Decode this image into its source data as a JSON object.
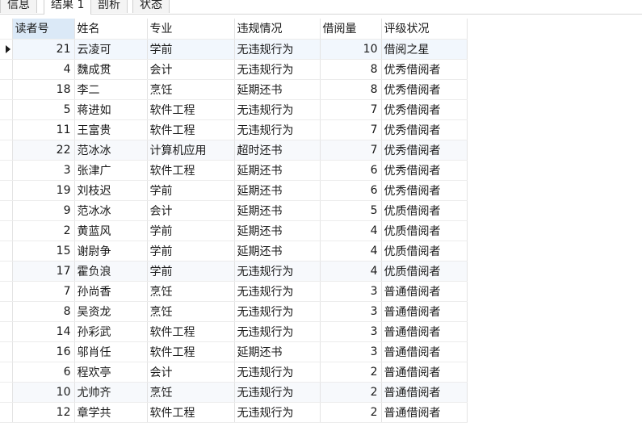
{
  "tabs": [
    {
      "label": "信息",
      "active": false
    },
    {
      "label": "结果 1",
      "active": true
    },
    {
      "label": "剖析",
      "active": false
    },
    {
      "label": "状态",
      "active": false
    }
  ],
  "table": {
    "columns": [
      "读者号",
      "姓名",
      "专业",
      "违规情况",
      "借阅量",
      "评级状况"
    ],
    "rows": [
      [
        "21",
        "云凌可",
        "学前",
        "无违规行为",
        "10",
        "借阅之星"
      ],
      [
        "4",
        "魏成贯",
        "会计",
        "无违规行为",
        "8",
        "优秀借阅者"
      ],
      [
        "18",
        "李二",
        "烹饪",
        "延期还书",
        "8",
        "优秀借阅者"
      ],
      [
        "5",
        "蒋进如",
        "软件工程",
        "无违规行为",
        "7",
        "优秀借阅者"
      ],
      [
        "11",
        "王富贵",
        "软件工程",
        "无违规行为",
        "7",
        "优秀借阅者"
      ],
      [
        "22",
        "范冰冰",
        "计算机应用",
        "超时还书",
        "7",
        "优秀借阅者"
      ],
      [
        "3",
        "张津广",
        "软件工程",
        "延期还书",
        "6",
        "优秀借阅者"
      ],
      [
        "19",
        "刘枝迟",
        "学前",
        "延期还书",
        "6",
        "优秀借阅者"
      ],
      [
        "9",
        "范冰冰",
        "会计",
        "延期还书",
        "5",
        "优质借阅者"
      ],
      [
        "2",
        "黄蓝风",
        "学前",
        "延期还书",
        "4",
        "优质借阅者"
      ],
      [
        "15",
        "谢尉争",
        "学前",
        "延期还书",
        "4",
        "优质借阅者"
      ],
      [
        "17",
        "霍负浪",
        "学前",
        "无违规行为",
        "4",
        "优质借阅者"
      ],
      [
        "7",
        "孙尚香",
        "烹饪",
        "无违规行为",
        "3",
        "普通借阅者"
      ],
      [
        "8",
        "吴资龙",
        "烹饪",
        "无违规行为",
        "3",
        "普通借阅者"
      ],
      [
        "14",
        "孙彩武",
        "软件工程",
        "无违规行为",
        "3",
        "普通借阅者"
      ],
      [
        "16",
        "邬肖任",
        "软件工程",
        "延期还书",
        "3",
        "普通借阅者"
      ],
      [
        "6",
        "程欢亭",
        "会计",
        "无违规行为",
        "2",
        "普通借阅者"
      ],
      [
        "10",
        "尤帅齐",
        "烹饪",
        "无违规行为",
        "2",
        "普通借阅者"
      ],
      [
        "12",
        "章学共",
        "软件工程",
        "无违规行为",
        "2",
        "普通借阅者"
      ]
    ]
  },
  "colors": {
    "header_sorted": "#dbe9f7",
    "row_alt": "#f7f9fc"
  }
}
